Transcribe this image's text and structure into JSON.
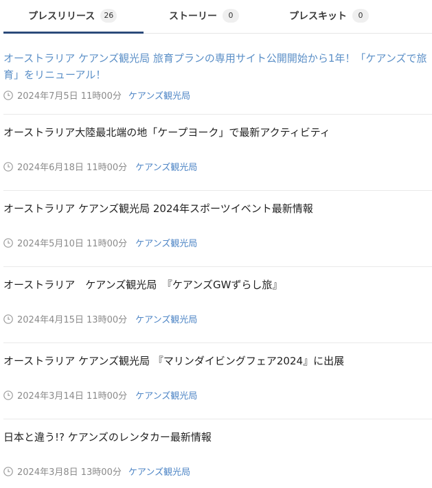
{
  "tabs": [
    {
      "label": "プレスリリース",
      "count": "26"
    },
    {
      "label": "ストーリー",
      "count": "0"
    },
    {
      "label": "プレスキット",
      "count": "0"
    }
  ],
  "items": [
    {
      "title": "オーストラリア ケアンズ観光局 旅育プランの専用サイト公開開始から1年！「ケアンズで旅育」をリニューアル！",
      "date": "2024年7月5日 11時00分",
      "company": "ケアンズ観光局"
    },
    {
      "title": "オーストラリア大陸最北端の地「ケープヨーク」で最新アクティビティ",
      "date": "2024年6月18日 11時00分",
      "company": "ケアンズ観光局"
    },
    {
      "title": "オーストラリア ケアンズ観光局 2024年スポーツイベント最新情報",
      "date": "2024年5月10日 11時00分",
      "company": "ケアンズ観光局"
    },
    {
      "title": "オーストラリア　ケアンズ観光局　『ケアンズGWずらし旅』",
      "date": "2024年4月15日 13時00分",
      "company": "ケアンズ観光局"
    },
    {
      "title": "オーストラリア ケアンズ観光局 『マリンダイビングフェア2024』に出展",
      "date": "2024年3月14日 11時00分",
      "company": "ケアンズ観光局"
    },
    {
      "title": "日本と違う!? ケアンズのレンタカー最新情報",
      "date": "2024年3月8日 13時00分",
      "company": "ケアンズ観光局"
    }
  ],
  "colors": {
    "active_tab_underline": "#2b4a7a",
    "visited_link": "#5b8fc7",
    "company_link": "#4f86c6"
  },
  "icons": {
    "meta": "clock-icon"
  }
}
